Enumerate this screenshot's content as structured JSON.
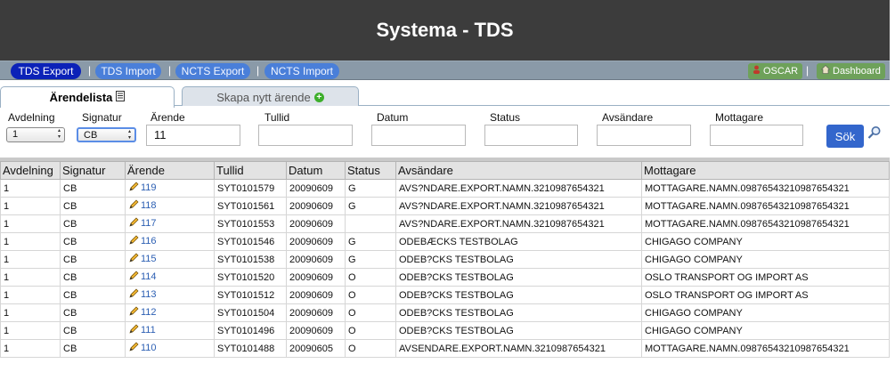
{
  "app": {
    "title": "Systema - TDS"
  },
  "nav": {
    "items": [
      "TDS Export",
      "TDS Import",
      "NCTS Export",
      "NCTS Import"
    ],
    "separator": "|",
    "user_label": "OSCAR",
    "dashboard_label": "Dashboard"
  },
  "tabs": {
    "active": "Ärendelista",
    "inactive": "Skapa nytt ärende"
  },
  "filters": {
    "avdelning_label": "Avdelning",
    "avdelning_value": "1",
    "signatur_label": "Signatur",
    "signatur_value": "CB",
    "arende_label": "Ärende",
    "arende_value": "11",
    "tullid_label": "Tullid",
    "tullid_value": "",
    "datum_label": "Datum",
    "datum_value": "",
    "status_label": "Status",
    "status_value": "",
    "avsandare_label": "Avsändare",
    "avsandare_value": "",
    "mottagare_label": "Mottagare",
    "mottagare_value": "",
    "search_label": "Sök"
  },
  "table": {
    "headers": [
      "Avdelning",
      "Signatur",
      "Ärende",
      "Tullid",
      "Datum",
      "Status",
      "Avsändare",
      "Mottagare"
    ],
    "rows": [
      [
        "1",
        "CB",
        "119",
        "SYT0101579",
        "20090609",
        "G",
        "AVS?NDARE.EXPORT.NAMN.3210987654321",
        "MOTTAGARE.NAMN.09876543210987654321"
      ],
      [
        "1",
        "CB",
        "118",
        "SYT0101561",
        "20090609",
        "G",
        "AVS?NDARE.EXPORT.NAMN.3210987654321",
        "MOTTAGARE.NAMN.09876543210987654321"
      ],
      [
        "1",
        "CB",
        "117",
        "SYT0101553",
        "20090609",
        "",
        "AVS?NDARE.EXPORT.NAMN.3210987654321",
        "MOTTAGARE.NAMN.09876543210987654321"
      ],
      [
        "1",
        "CB",
        "116",
        "SYT0101546",
        "20090609",
        "G",
        "ODEBÆCKS TESTBOLAG",
        "CHIGAGO COMPANY"
      ],
      [
        "1",
        "CB",
        "115",
        "SYT0101538",
        "20090609",
        "G",
        "ODEB?CKS TESTBOLAG",
        "CHIGAGO COMPANY"
      ],
      [
        "1",
        "CB",
        "114",
        "SYT0101520",
        "20090609",
        "O",
        "ODEB?CKS TESTBOLAG",
        "OSLO TRANSPORT OG IMPORT AS"
      ],
      [
        "1",
        "CB",
        "113",
        "SYT0101512",
        "20090609",
        "O",
        "ODEB?CKS TESTBOLAG",
        "OSLO TRANSPORT OG IMPORT AS"
      ],
      [
        "1",
        "CB",
        "112",
        "SYT0101504",
        "20090609",
        "O",
        "ODEB?CKS TESTBOLAG",
        "CHIGAGO COMPANY"
      ],
      [
        "1",
        "CB",
        "111",
        "SYT0101496",
        "20090609",
        "O",
        "ODEB?CKS TESTBOLAG",
        "CHIGAGO COMPANY"
      ],
      [
        "1",
        "CB",
        "110",
        "SYT0101488",
        "20090605",
        "O",
        "AVSENDARE.EXPORT.NAMN.3210987654321",
        "MOTTAGARE.NAMN.09876543210987654321"
      ]
    ]
  },
  "colors": {
    "header_bg": "#3c3c3c",
    "nav_bg": "#8a9aa8",
    "active_nav": "#0b22b8",
    "inactive_nav": "#4a7fd9",
    "search_button": "#3366cc",
    "link": "#2c5fb3"
  }
}
